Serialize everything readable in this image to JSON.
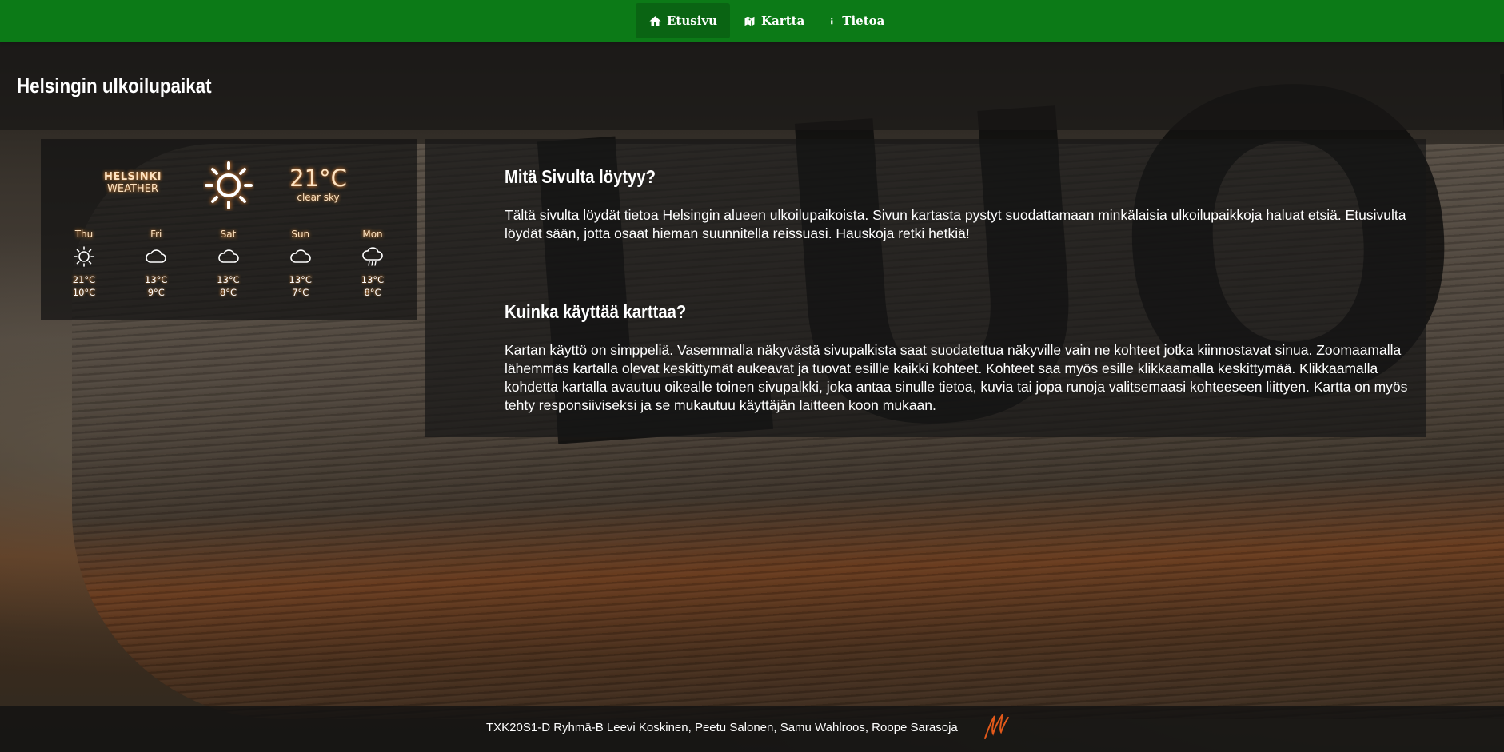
{
  "nav": {
    "items": [
      {
        "label": "Etusivu",
        "icon": "home-icon",
        "active": true
      },
      {
        "label": "Kartta",
        "icon": "map-icon",
        "active": false
      },
      {
        "label": "Tietoa",
        "icon": "info-icon",
        "active": false
      }
    ]
  },
  "header": {
    "title": "Helsingin ulkoilupaikat"
  },
  "weather": {
    "city": "HELSINKI",
    "label": "WEATHER",
    "current_icon": "sun-icon",
    "temperature": "21°C",
    "description": "clear sky",
    "forecast": [
      {
        "day": "Thu",
        "icon": "sun-icon",
        "high": "21°C",
        "low": "10°C"
      },
      {
        "day": "Fri",
        "icon": "cloud-icon",
        "high": "13°C",
        "low": "9°C"
      },
      {
        "day": "Sat",
        "icon": "cloud-icon",
        "high": "13°C",
        "low": "8°C"
      },
      {
        "day": "Sun",
        "icon": "cloud-icon",
        "high": "13°C",
        "low": "7°C"
      },
      {
        "day": "Mon",
        "icon": "rain-icon",
        "high": "13°C",
        "low": "8°C"
      }
    ]
  },
  "content": {
    "section1": {
      "title": "Mitä Sivulta löytyy?",
      "text": "Tältä sivulta löydät tietoa Helsingin alueen ulkoilupaikoista. Sivun kartasta pystyt suodattamaan minkälaisia ulkoilupaikkoja haluat etsiä. Etusivulta löydät sään, jotta osaat hieman suunnitella reissuasi. Hauskoja retki hetkiä!"
    },
    "section2": {
      "title": "Kuinka käyttää karttaa?",
      "text": "Kartan käyttö on simppeliä. Vasemmalla näkyvästä sivupalkista saat suodatettua näkyville vain ne kohteet jotka kiinnostavat sinua. Zoomaamalla lähemmäs kartalla olevat keskittymät aukeavat ja tuovat esillle kaikki kohteet. Kohteet saa myös esille klikkaamalla keskittymää. Klikkaamalla kohdetta kartalla avautuu oikealle toinen sivupalkki, joka antaa sinulle tietoa, kuvia tai jopa runoja valitsemaasi kohteeseen liittyen. Kartta on myös tehty responsiiviseksi ja se mukautuu käyttäjän laitteen koon mukaan."
    }
  },
  "footer": {
    "text": "TXK20S1-D Ryhmä-B Leevi Koskinen, Peetu Salonen, Samu Wahlroos, Roope Sarasoja",
    "logo_icon": "signature-logo"
  },
  "colors": {
    "navbar": "#0c7a17",
    "navbar_active": "#0a6413",
    "weather_accent": "#fde3c2"
  }
}
